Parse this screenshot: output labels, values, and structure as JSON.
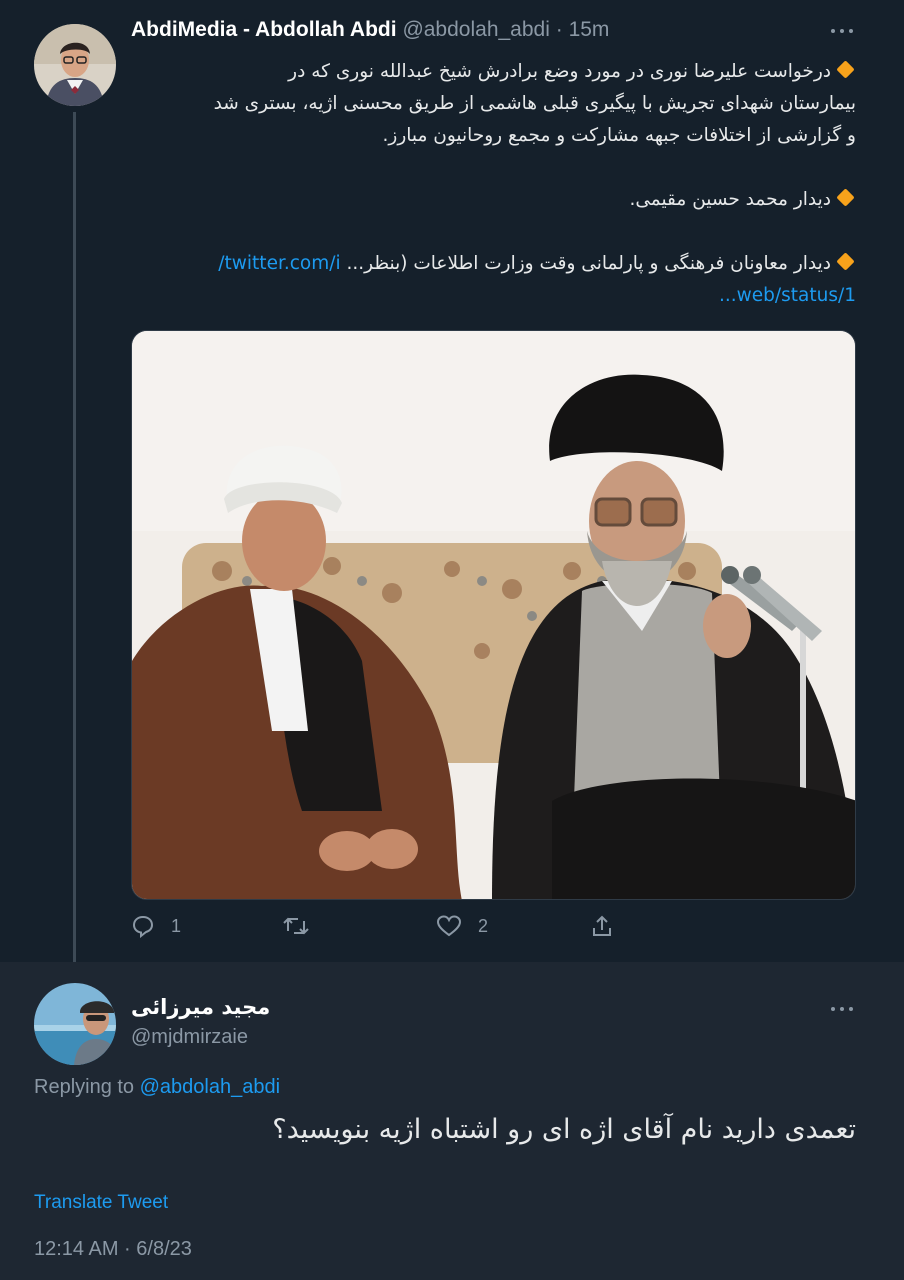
{
  "tweet1": {
    "display_name": "AbdiMedia - Abdollah Abdi",
    "handle": "@abdolah_abdi",
    "separator": "·",
    "time_ago": "15m",
    "body_lines": [
      "درخواست علیرضا نوری در مورد وضع برادرش شیخ عبدالله نوری که در",
      "بیمارستان شهدای تجریش با پیگیری قبلی هاشمی از طریق محسنی اژیه، بستری شد",
      "و گزارشی از اختلافات جبهه مشارکت و مجمع روحانیون مبارز."
    ],
    "line2": "دیدار محمد حسین مقیمی.",
    "line3": "دیدار معاونان فرهنگی و پارلمانی وقت وزارت اطلاعات (بنظر...",
    "link_part1": "twitter.com/i/",
    "link_part2": "web/status/1...",
    "actions": {
      "reply_count": "1",
      "retweet_count": "",
      "like_count": "2"
    }
  },
  "tweet2": {
    "display_name": "مجید میرزائی",
    "handle": "@mjdmirzaie",
    "replying_label": "Replying to",
    "replying_to": "@abdolah_abdi",
    "text": "تعمدی دارید نام آقای اژه ای رو اشتباه اژیه بنویسید؟",
    "translate_label": "Translate Tweet",
    "timestamp": "12:14 AM · 6/8/23"
  },
  "colors": {
    "background": "#15202b",
    "reply_background": "#1e2732",
    "link": "#1d9bf0",
    "muted": "#8b98a5",
    "emoji_diamond": "#f7a21b"
  },
  "icons": [
    "more-icon",
    "reply-icon",
    "retweet-icon",
    "like-icon",
    "share-icon",
    "orange-diamond-icon"
  ]
}
